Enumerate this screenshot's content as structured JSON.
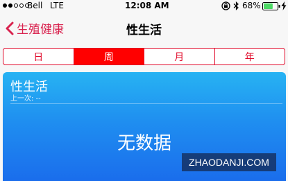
{
  "status_bar": {
    "carrier": "Bell",
    "network": "LTE",
    "time": "12:08 AM",
    "battery_percent": "68%",
    "signal_filled": 2,
    "signal_total": 5,
    "battery_level": 0.68,
    "icons": [
      "orientation-lock-icon",
      "bluetooth-icon",
      "battery-icon",
      "charging-bolt-icon"
    ]
  },
  "nav": {
    "back_label": "生殖健康",
    "title": "性生活",
    "accent_color": "#d9234f"
  },
  "segments": {
    "items": [
      "日",
      "周",
      "月",
      "年"
    ],
    "selected": "周",
    "accent_color": "#ff0000"
  },
  "card": {
    "title": "性生活",
    "subtitle": "上一次: --",
    "empty_text": "无数据"
  },
  "watermark": "ZHAODANJI.COM"
}
